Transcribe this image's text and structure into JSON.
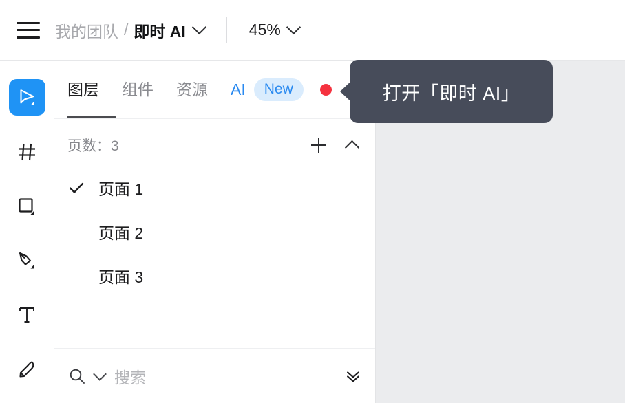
{
  "topbar": {
    "menu_icon": "hamburger-menu-icon",
    "breadcrumb": {
      "team": "我的团队",
      "separator": "/",
      "file": "即时 AI",
      "chevron_icon": "chevron-down-icon"
    },
    "zoom": {
      "level": "45%",
      "chevron_icon": "chevron-down-icon"
    }
  },
  "toolbar": {
    "tools": [
      {
        "name": "cursor-tool",
        "icon": "cursor-arrow-icon",
        "active": true,
        "has_submenu": true
      },
      {
        "name": "frame-tool",
        "icon": "frame-grid-icon",
        "active": false,
        "has_submenu": false
      },
      {
        "name": "shape-tool",
        "icon": "rectangle-icon",
        "active": false,
        "has_submenu": true
      },
      {
        "name": "pen-tool",
        "icon": "pen-icon",
        "active": false,
        "has_submenu": true
      },
      {
        "name": "text-tool",
        "icon": "text-t-icon",
        "active": false,
        "has_submenu": false
      },
      {
        "name": "slice-tool",
        "icon": "knife-slice-icon",
        "active": false,
        "has_submenu": false
      }
    ]
  },
  "panel": {
    "tabs": [
      {
        "label": "图层",
        "active": true
      },
      {
        "label": "组件",
        "active": false
      },
      {
        "label": "资源",
        "active": false
      },
      {
        "label": "AI",
        "active": false,
        "accent": true
      }
    ],
    "new_badge": "New",
    "red_dot": "notification-dot",
    "pages": {
      "count_label": "页数：3",
      "add_icon": "plus-icon",
      "collapse_icon": "chevron-up-icon",
      "items": [
        {
          "label": "页面 1",
          "selected": true
        },
        {
          "label": "页面 2",
          "selected": false
        },
        {
          "label": "页面 3",
          "selected": false
        }
      ]
    },
    "search": {
      "icon": "search-icon",
      "filter_icon": "chevron-down-icon",
      "placeholder": "搜索",
      "value": "",
      "collapse_all_icon": "double-chevron-down-icon"
    }
  },
  "tooltip": {
    "text": "打开「即时 AI」"
  },
  "colors": {
    "accent_blue": "#1f93f5",
    "tab_ai_blue": "#2a8af0",
    "badge_bg": "#daecfd",
    "red_dot": "#f5323f",
    "tooltip_bg": "#474c5a",
    "canvas_bg": "#ebecee"
  }
}
